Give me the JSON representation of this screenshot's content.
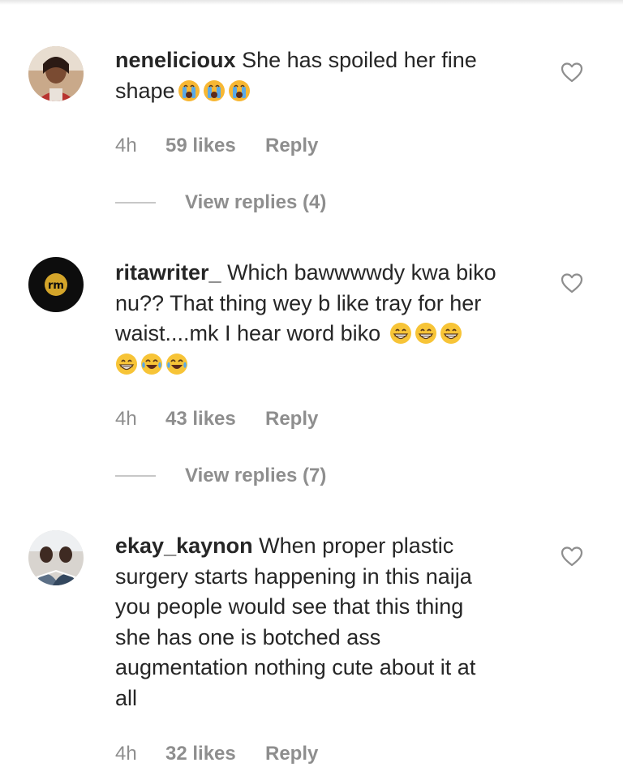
{
  "comments": [
    {
      "username": "nenelicioux",
      "lines": [
        "She has spoiled her fine",
        "shape"
      ],
      "emoji": [
        "loudly-crying-face",
        "loudly-crying-face",
        "loudly-crying-face"
      ],
      "time": "4h",
      "likes": "59 likes",
      "reply": "Reply",
      "view_replies": "View replies (4)"
    },
    {
      "username": "ritawriter_",
      "lines": [
        "Which bawwwwdy kwa biko",
        "nu?? That thing wey b like tray for her",
        "waist....mk I hear word biko"
      ],
      "emoji_line3": [
        "grinning-face",
        "grinning-face",
        "grinning-face"
      ],
      "emoji_line4": [
        "grinning-face",
        "tears-of-joy-face",
        "tears-of-joy-face"
      ],
      "avatar_text": "rm",
      "time": "4h",
      "likes": "43 likes",
      "reply": "Reply",
      "view_replies": "View replies (7)"
    },
    {
      "username": "ekay_kaynon",
      "lines": [
        "When proper plastic",
        "surgery starts happening in this naija",
        "you people would see that this thing",
        "she has one is botched ass",
        "augmentation nothing cute about it at",
        "all"
      ],
      "time": "4h",
      "likes": "32 likes",
      "reply": "Reply"
    }
  ],
  "icons": {
    "like": "heart-outline-icon"
  },
  "colors": {
    "text": "#262626",
    "muted": "#8e8e8e",
    "divider": "#c7c7c7"
  }
}
